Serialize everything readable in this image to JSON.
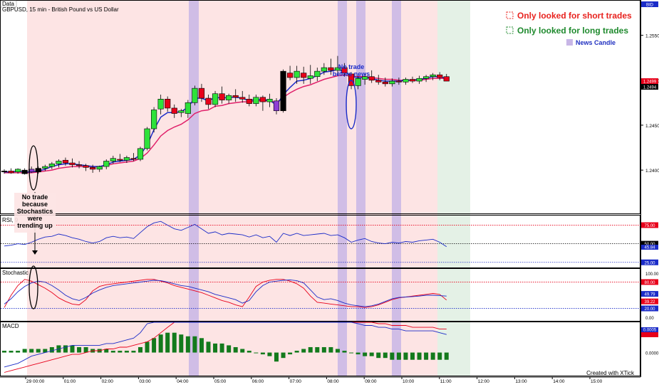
{
  "window": {
    "tab_label": "Data",
    "chart_title": "GBPUSD, 15 min - British Pound vs US Dollar",
    "credit": "Created with XTick"
  },
  "legend": {
    "short_label": "Only looked for short trades",
    "long_label": "Only looked for long trades",
    "news_label": "News Candle",
    "short_color": "#e8231f",
    "long_color": "#1f8a2e",
    "news_color": "#c8b6e6"
  },
  "annotations": {
    "no_trade_stoch": "No trade because Stochastics were trending up",
    "no_trade_news": "No trade before news"
  },
  "chart_data": [
    {
      "type": "candlestick",
      "panel": "price",
      "symbol_badge": "BID",
      "y_ticks": [
        "1.2550",
        "1.2500",
        "1.2450",
        "1.2400"
      ],
      "ylim": [
        1.2355,
        1.2575
      ],
      "price_badges": [
        "1.2499",
        "1.2494"
      ],
      "time_labels": [
        "29 00:00",
        "01:00",
        "02:00",
        "03:00",
        "04:00",
        "05:00",
        "06:00",
        "07:00",
        "08:00",
        "09:00",
        "10:00",
        "11:00",
        "12:00",
        "13:00",
        "14:00",
        "15:00"
      ],
      "candles": [
        {
          "o": 1.2398,
          "h": 1.2401,
          "l": 1.2396,
          "c": 1.2399
        },
        {
          "o": 1.2399,
          "h": 1.2402,
          "l": 1.2396,
          "c": 1.2397
        },
        {
          "o": 1.2398,
          "h": 1.2402,
          "l": 1.2396,
          "c": 1.2401
        },
        {
          "o": 1.24,
          "h": 1.2402,
          "l": 1.2395,
          "c": 1.2396
        },
        {
          "o": 1.2401,
          "h": 1.2404,
          "l": 1.2397,
          "c": 1.2398
        },
        {
          "o": 1.2398,
          "h": 1.2404,
          "l": 1.2396,
          "c": 1.2402
        },
        {
          "o": 1.2402,
          "h": 1.2406,
          "l": 1.2399,
          "c": 1.2404
        },
        {
          "o": 1.2404,
          "h": 1.2409,
          "l": 1.2401,
          "c": 1.2407
        },
        {
          "o": 1.2407,
          "h": 1.2412,
          "l": 1.2403,
          "c": 1.241
        },
        {
          "o": 1.2411,
          "h": 1.2414,
          "l": 1.2405,
          "c": 1.2408
        },
        {
          "o": 1.2408,
          "h": 1.2413,
          "l": 1.2403,
          "c": 1.2406
        },
        {
          "o": 1.2406,
          "h": 1.241,
          "l": 1.2402,
          "c": 1.2405
        },
        {
          "o": 1.2405,
          "h": 1.2407,
          "l": 1.2399,
          "c": 1.2403
        },
        {
          "o": 1.2403,
          "h": 1.2406,
          "l": 1.2397,
          "c": 1.2401
        },
        {
          "o": 1.2401,
          "h": 1.2405,
          "l": 1.2398,
          "c": 1.2404
        },
        {
          "o": 1.2404,
          "h": 1.2412,
          "l": 1.2401,
          "c": 1.241
        },
        {
          "o": 1.241,
          "h": 1.2416,
          "l": 1.2407,
          "c": 1.2413
        },
        {
          "o": 1.2412,
          "h": 1.2418,
          "l": 1.2409,
          "c": 1.2411
        },
        {
          "o": 1.2411,
          "h": 1.2416,
          "l": 1.2408,
          "c": 1.2414
        },
        {
          "o": 1.2413,
          "h": 1.2419,
          "l": 1.241,
          "c": 1.2412
        },
        {
          "o": 1.2412,
          "h": 1.2426,
          "l": 1.241,
          "c": 1.2424
        },
        {
          "o": 1.2424,
          "h": 1.2448,
          "l": 1.2422,
          "c": 1.2446
        },
        {
          "o": 1.2446,
          "h": 1.247,
          "l": 1.2442,
          "c": 1.2467
        },
        {
          "o": 1.2468,
          "h": 1.2484,
          "l": 1.2462,
          "c": 1.2479
        },
        {
          "o": 1.2479,
          "h": 1.2482,
          "l": 1.2465,
          "c": 1.2469
        },
        {
          "o": 1.2469,
          "h": 1.2473,
          "l": 1.2458,
          "c": 1.2463
        },
        {
          "o": 1.2464,
          "h": 1.2468,
          "l": 1.2459,
          "c": 1.2466
        },
        {
          "o": 1.2463,
          "h": 1.2478,
          "l": 1.2458,
          "c": 1.2475
        },
        {
          "o": 1.2475,
          "h": 1.2494,
          "l": 1.2472,
          "c": 1.2491
        },
        {
          "o": 1.2491,
          "h": 1.2496,
          "l": 1.2476,
          "c": 1.248
        },
        {
          "o": 1.248,
          "h": 1.2484,
          "l": 1.2468,
          "c": 1.2473
        },
        {
          "o": 1.2473,
          "h": 1.2488,
          "l": 1.247,
          "c": 1.2485
        },
        {
          "o": 1.2485,
          "h": 1.2493,
          "l": 1.2474,
          "c": 1.2478
        },
        {
          "o": 1.2478,
          "h": 1.2485,
          "l": 1.2474,
          "c": 1.2483
        },
        {
          "o": 1.2483,
          "h": 1.249,
          "l": 1.2476,
          "c": 1.2481
        },
        {
          "o": 1.2481,
          "h": 1.2488,
          "l": 1.2475,
          "c": 1.2479
        },
        {
          "o": 1.2479,
          "h": 1.2484,
          "l": 1.2471,
          "c": 1.2474
        },
        {
          "o": 1.2474,
          "h": 1.2484,
          "l": 1.2471,
          "c": 1.2481
        },
        {
          "o": 1.2481,
          "h": 1.2483,
          "l": 1.2466,
          "c": 1.2476
        },
        {
          "o": 1.2476,
          "h": 1.2485,
          "l": 1.247,
          "c": 1.2479
        },
        {
          "o": 1.2477,
          "h": 1.248,
          "l": 1.2462,
          "c": 1.2466
        },
        {
          "o": 1.2466,
          "h": 1.2512,
          "l": 1.2464,
          "c": 1.251
        },
        {
          "o": 1.2508,
          "h": 1.2516,
          "l": 1.25,
          "c": 1.2503
        },
        {
          "o": 1.2503,
          "h": 1.2516,
          "l": 1.2496,
          "c": 1.251
        },
        {
          "o": 1.2508,
          "h": 1.2515,
          "l": 1.2496,
          "c": 1.2503
        },
        {
          "o": 1.2502,
          "h": 1.2517,
          "l": 1.2496,
          "c": 1.2505
        },
        {
          "o": 1.2504,
          "h": 1.2514,
          "l": 1.2499,
          "c": 1.251
        },
        {
          "o": 1.251,
          "h": 1.2519,
          "l": 1.2506,
          "c": 1.2514
        },
        {
          "o": 1.2514,
          "h": 1.2524,
          "l": 1.2506,
          "c": 1.2511
        },
        {
          "o": 1.2511,
          "h": 1.2527,
          "l": 1.2505,
          "c": 1.2514
        },
        {
          "o": 1.2514,
          "h": 1.2519,
          "l": 1.2504,
          "c": 1.2508
        },
        {
          "o": 1.2507,
          "h": 1.2509,
          "l": 1.249,
          "c": 1.2494
        },
        {
          "o": 1.2494,
          "h": 1.2505,
          "l": 1.249,
          "c": 1.2502
        },
        {
          "o": 1.2501,
          "h": 1.2507,
          "l": 1.2495,
          "c": 1.2504
        },
        {
          "o": 1.2504,
          "h": 1.2511,
          "l": 1.2497,
          "c": 1.25
        },
        {
          "o": 1.25,
          "h": 1.2506,
          "l": 1.2495,
          "c": 1.2498
        },
        {
          "o": 1.2498,
          "h": 1.2503,
          "l": 1.2493,
          "c": 1.2496
        },
        {
          "o": 1.2496,
          "h": 1.2502,
          "l": 1.2493,
          "c": 1.2499
        },
        {
          "o": 1.2499,
          "h": 1.2503,
          "l": 1.2495,
          "c": 1.2498
        },
        {
          "o": 1.2498,
          "h": 1.2503,
          "l": 1.2495,
          "c": 1.2501
        },
        {
          "o": 1.2501,
          "h": 1.2504,
          "l": 1.2497,
          "c": 1.2499
        },
        {
          "o": 1.2499,
          "h": 1.2505,
          "l": 1.2496,
          "c": 1.2502
        },
        {
          "o": 1.2502,
          "h": 1.2506,
          "l": 1.2498,
          "c": 1.2504
        },
        {
          "o": 1.2504,
          "h": 1.2508,
          "l": 1.25,
          "c": 1.2506
        },
        {
          "o": 1.2506,
          "h": 1.2509,
          "l": 1.25,
          "c": 1.2503
        },
        {
          "o": 1.2504,
          "h": 1.2507,
          "l": 1.2499,
          "c": 1.2499
        }
      ],
      "ema_fast": [
        1.2398,
        1.2398,
        1.2399,
        1.2398,
        1.2398,
        1.2399,
        1.2401,
        1.2404,
        1.2406,
        1.2407,
        1.2407,
        1.2406,
        1.2405,
        1.2404,
        1.2404,
        1.2406,
        1.2409,
        1.241,
        1.2411,
        1.2412,
        1.2417,
        1.2428,
        1.2445,
        1.2459,
        1.2464,
        1.2464,
        1.2465,
        1.247,
        1.248,
        1.248,
        1.2477,
        1.2481,
        1.248,
        1.2481,
        1.2481,
        1.248,
        1.2477,
        1.2479,
        1.2478,
        1.2478,
        1.2472,
        1.2484,
        1.2492,
        1.2499,
        1.25,
        1.2502,
        1.2505,
        1.2509,
        1.251,
        1.2512,
        1.251,
        1.2504,
        1.2503,
        1.2503,
        1.2502,
        1.25,
        1.2499,
        1.2499,
        1.2499,
        1.25,
        1.25,
        1.2501,
        1.2502,
        1.2504,
        1.2504,
        1.2502
      ],
      "ema_slow": [
        1.2397,
        1.2397,
        1.2397,
        1.2397,
        1.2397,
        1.2398,
        1.2399,
        1.24,
        1.2402,
        1.2403,
        1.2404,
        1.2404,
        1.2404,
        1.2404,
        1.2404,
        1.2405,
        1.2407,
        1.2408,
        1.2409,
        1.241,
        1.2413,
        1.2419,
        1.2428,
        1.2438,
        1.2444,
        1.2448,
        1.2451,
        1.2456,
        1.2463,
        1.2466,
        1.2467,
        1.2471,
        1.2472,
        1.2474,
        1.2475,
        1.2476,
        1.2476,
        1.2477,
        1.2477,
        1.2477,
        1.2475,
        1.2481,
        1.2486,
        1.249,
        1.2493,
        1.2495,
        1.2498,
        1.2501,
        1.2503,
        1.2505,
        1.2506,
        1.2504,
        1.2504,
        1.2504,
        1.2503,
        1.2502,
        1.2501,
        1.2501,
        1.25,
        1.25,
        1.25,
        1.25,
        1.2501,
        1.2502,
        1.2502,
        1.2502
      ]
    },
    {
      "type": "line",
      "panel": "rsi",
      "title": "RSI, 9",
      "ylim": [
        20,
        85
      ],
      "levels": [
        75,
        50,
        25
      ],
      "level_labels": [
        "75.00",
        "50.00",
        "25.00"
      ],
      "value_badge": "45.84",
      "series": [
        {
          "values": [
            47,
            48,
            50,
            49,
            52,
            56,
            59,
            60,
            63,
            61,
            58,
            56,
            53,
            51,
            53,
            58,
            60,
            58,
            59,
            57,
            65,
            73,
            78,
            80,
            75,
            70,
            68,
            72,
            76,
            70,
            64,
            66,
            62,
            64,
            63,
            62,
            59,
            62,
            58,
            60,
            52,
            64,
            61,
            64,
            61,
            62,
            63,
            64,
            61,
            62,
            58,
            52,
            55,
            57,
            53,
            51,
            50,
            52,
            51,
            53,
            52,
            54,
            55,
            56,
            52,
            46
          ]
        }
      ]
    },
    {
      "type": "line",
      "panel": "stochastic",
      "title": "Stochastic",
      "ylim": [
        -5,
        105
      ],
      "levels": [
        80,
        20
      ],
      "y_ticks": [
        "100.00",
        "0.00"
      ],
      "level_labels": [
        "80.00",
        "20.00"
      ],
      "value_badges": [
        "49.79",
        "39.22"
      ],
      "series": [
        {
          "values": [
            30,
            42,
            58,
            70,
            78,
            82,
            80,
            72,
            62,
            50,
            42,
            38,
            45,
            55,
            62,
            68,
            72,
            74,
            76,
            78,
            80,
            82,
            84,
            83,
            80,
            76,
            72,
            70,
            66,
            62,
            58,
            52,
            48,
            44,
            40,
            32,
            38,
            58,
            72,
            80,
            82,
            84,
            85,
            83,
            78,
            62,
            46,
            40,
            42,
            38,
            32,
            28,
            26,
            24,
            26,
            30,
            36,
            42,
            45,
            46,
            47,
            48,
            50,
            50,
            49,
            48
          ]
        },
        {
          "values": [
            22,
            50,
            72,
            86,
            82,
            74,
            66,
            56,
            44,
            36,
            30,
            28,
            40,
            60,
            70,
            74,
            76,
            78,
            80,
            82,
            84,
            86,
            86,
            82,
            78,
            72,
            68,
            64,
            60,
            56,
            50,
            44,
            38,
            34,
            28,
            24,
            46,
            70,
            80,
            84,
            86,
            86,
            82,
            76,
            66,
            48,
            34,
            32,
            30,
            28,
            26,
            24,
            24,
            22,
            24,
            28,
            34,
            40,
            44,
            46,
            48,
            50,
            52,
            54,
            52,
            39
          ]
        }
      ]
    },
    {
      "type": "bar",
      "panel": "macd",
      "title": "MACD",
      "y_ticks": [
        "0.0000"
      ],
      "badges": [
        "0.0005",
        "0.0000"
      ],
      "ylim": [
        -0.0012,
        0.0016
      ],
      "values": [
        0.0001,
        0.0001,
        0.0001,
        0.0002,
        0.0002,
        0.0002,
        0.0002,
        0.0003,
        0.0004,
        0.0004,
        0.0004,
        0.0003,
        0.0003,
        0.0002,
        0.0002,
        0.0002,
        0.0001,
        0.0001,
        0.0001,
        0.0001,
        0.0003,
        0.0006,
        0.0008,
        0.001,
        0.0011,
        0.0011,
        0.001,
        0.0009,
        0.0009,
        0.0008,
        0.0006,
        0.0005,
        0.0005,
        0.0004,
        0.0003,
        0.0002,
        0.0001,
        0.0,
        -0.0001,
        -0.0002,
        -0.0005,
        -0.0003,
        -0.0001,
        0.0001,
        0.0002,
        0.0003,
        0.0003,
        0.0003,
        0.0003,
        0.0002,
        0.0001,
        0.0,
        -0.0001,
        -0.0002,
        -0.0002,
        -0.0003,
        -0.0003,
        -0.0004,
        -0.0004,
        -0.0004,
        -0.0004,
        -0.0004,
        -0.0004,
        -0.0004,
        -0.0004,
        -0.0004
      ],
      "macd_line": [
        -0.0008,
        -0.0007,
        -0.0006,
        -0.0004,
        -0.0002,
        -0.0001,
        0.0,
        0.0001,
        0.0002,
        0.0003,
        0.0004,
        0.0004,
        0.0004,
        0.0004,
        0.0004,
        0.0005,
        0.0005,
        0.0006,
        0.0007,
        0.0008,
        0.0011,
        0.0016,
        0.0021,
        0.0025,
        0.0027,
        0.0028,
        0.0028,
        0.0029,
        0.003,
        0.003,
        0.0029,
        0.0028,
        0.0027,
        0.0026,
        0.0025,
        0.0024,
        0.0023,
        0.0022,
        0.0021,
        0.002,
        0.0018,
        0.0019,
        0.002,
        0.0021,
        0.0021,
        0.0021,
        0.002,
        0.002,
        0.002,
        0.0019,
        0.0018,
        0.0017,
        0.0016,
        0.0015,
        0.0015,
        0.0014,
        0.0014,
        0.0013,
        0.0013,
        0.0012,
        0.0012,
        0.0012,
        0.0012,
        0.0012,
        0.0011,
        0.001
      ],
      "signal_line": [
        -0.0011,
        -0.001,
        -0.0009,
        -0.0008,
        -0.0007,
        -0.0006,
        -0.0005,
        -0.0004,
        -0.0003,
        -0.0002,
        -0.0001,
        -0.0001,
        0.0,
        0.0001,
        0.0001,
        0.0002,
        0.0002,
        0.0003,
        0.0003,
        0.0004,
        0.0005,
        0.0006,
        0.0008,
        0.0011,
        0.0014,
        0.0017,
        0.0019,
        0.0021,
        0.0022,
        0.0023,
        0.0024,
        0.0024,
        0.0024,
        0.0024,
        0.0024,
        0.0024,
        0.0024,
        0.0023,
        0.0023,
        0.0022,
        0.0022,
        0.0021,
        0.0021,
        0.0021,
        0.0021,
        0.0021,
        0.0021,
        0.0021,
        0.002,
        0.002,
        0.0019,
        0.0019,
        0.0018,
        0.0017,
        0.0017,
        0.0016,
        0.0016,
        0.0015,
        0.0015,
        0.0015,
        0.0014,
        0.0014,
        0.0014,
        0.0014,
        0.0013,
        0.0013
      ]
    }
  ],
  "zones": {
    "short_zone_color": "#fde4e4",
    "long_zone_color": "#e4f1e6",
    "news_columns_color": "#c8b6e6"
  }
}
